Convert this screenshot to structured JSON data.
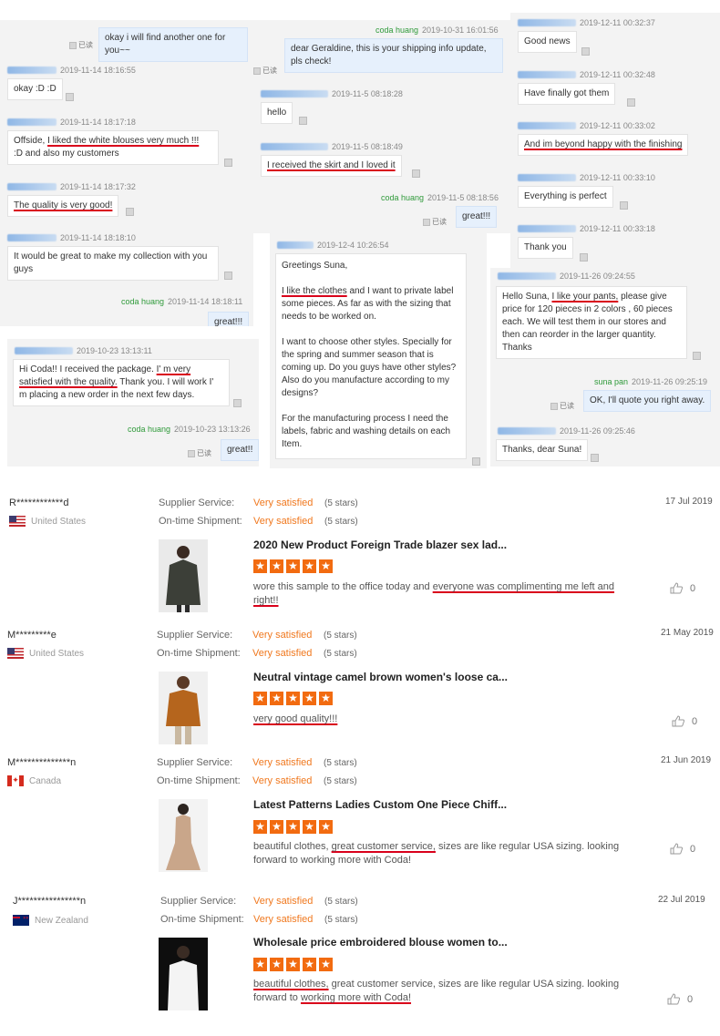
{
  "chat1": {
    "msgs": [
      {
        "text": "okay i will find another one for you~~",
        "read": "已读"
      },
      {
        "time": "2019-11-14 18:16:55",
        "text": "okay :D :D"
      },
      {
        "time": "2019-11-14 18:17:18",
        "text_a": "Offside, ",
        "text_ul": "I liked the white blouses very much !!!",
        "text_b": ":D and also my customers"
      },
      {
        "time": "2019-11-14 18:17:32",
        "text_ul": "The quality is very good!"
      },
      {
        "time": "2019-11-14 18:18:10",
        "text": "It would be great to make my collection with you guys"
      },
      {
        "seller": "coda huang",
        "time": "2019-11-14 18:18:11",
        "text": "great!!!"
      }
    ]
  },
  "chat2": {
    "seller": "coda huang",
    "time1": "2019-10-31 16:01:56",
    "text1": "dear Geraldine, this is your shipping info update, pls check!",
    "read": "已读",
    "time2": "2019-11-5 08:18:28",
    "text2": "hello",
    "time3": "2019-11-5 08:18:49",
    "text3": "I received the skirt and I loved it",
    "time4": "2019-11-5 08:18:56",
    "text4": "great!!!"
  },
  "chat3": {
    "msgs": [
      {
        "time": "2019-12-11 00:32:37",
        "text": "Good news"
      },
      {
        "time": "2019-12-11 00:32:48",
        "text": "Have finally got them"
      },
      {
        "time": "2019-12-11 00:33:02",
        "text": "And im beyond happy with the finishing"
      },
      {
        "time": "2019-12-11 00:33:10",
        "text": "Everything is perfect"
      },
      {
        "time": "2019-12-11 00:33:18",
        "text": "Thank you"
      }
    ]
  },
  "chat4": {
    "time": "2019-10-23 13:13:11",
    "text_a": "Hi Coda!! I received the package. ",
    "text_ul": "I' m very satisfied with the quality.",
    "text_b": " Thank you. I will work I' m placing a new order in the next few days.",
    "seller": "coda huang",
    "time2": "2019-10-23 13:13:26",
    "read": "已读",
    "text2": "great!!"
  },
  "chat5": {
    "time": "2019-12-4 10:26:54",
    "greeting": "Greetings Suna,",
    "p1_ul": "I like the clothes",
    "p1_b": " and I want to private label some pieces. As far as with the sizing that needs to be worked on.",
    "p2": "I want to choose other styles. Specially for the spring and summer season that is coming up. Do you guys have other styles? Also do you manufacture according to my designs?",
    "p3": "For the manufacturing process I need the labels, fabric and washing details on each Item."
  },
  "chat6": {
    "time1": "2019-11-26 09:24:55",
    "text1_a": "Hello Suna, ",
    "text1_ul": "I like your pants,",
    "text1_b": " please give price for 120 pieces in 2 colors , 60 pieces each. We will test them in our stores and then can reorder in the larger quantity. Thanks",
    "seller": "suna pan",
    "time2": "2019-11-26 09:25:19",
    "text2": "OK, I'll quote you right away.",
    "read": "已读",
    "time3": "2019-11-26 09:25:46",
    "text3": "Thanks, dear Suna!"
  },
  "labels": {
    "supplier_service": "Supplier Service:",
    "ontime": "On-time Shipment:",
    "very_satisfied": "Very satisfied",
    "five_stars": "(5 stars)"
  },
  "reviews": [
    {
      "user": "R************d",
      "country": "United States",
      "date": "17 Jul 2019",
      "title": "2020 New Product Foreign Trade blazer sex lad...",
      "text_a": "wore this sample to the office today and ",
      "text_ul": "everyone was complimenting me left and right!!",
      "text_b": "",
      "likes": "0"
    },
    {
      "user": "M*********e",
      "country": "United States",
      "date": "21 May 2019",
      "title": "Neutral vintage camel brown women's loose ca...",
      "text_a": "",
      "text_ul": "very good quality!!!",
      "text_b": "",
      "likes": "0"
    },
    {
      "user": "M**************n",
      "country": "Canada",
      "date": "21 Jun 2019",
      "title": "Latest Patterns Ladies Custom One Piece Chiff...",
      "text_a": "beautiful clothes, ",
      "text_ul": "great customer service,",
      "text_b": " sizes are like regular USA sizing. looking forward to working more with Coda!",
      "likes": "0"
    },
    {
      "user": "J****************n",
      "country": "New Zealand",
      "date": "22 Jul 2019",
      "title": "Wholesale price embroidered blouse women to...",
      "text_a": "",
      "text_ul": "beautiful clothes,",
      "text_b": " great customer service, sizes are like regular USA sizing. looking forward to ",
      "text_ul2": "working more with Coda!",
      "likes": "0"
    }
  ],
  "colors": {
    "accent": "#f0781e",
    "star": "#f26b10",
    "underline": "#d9001b",
    "seller": "#2f9a3a"
  }
}
